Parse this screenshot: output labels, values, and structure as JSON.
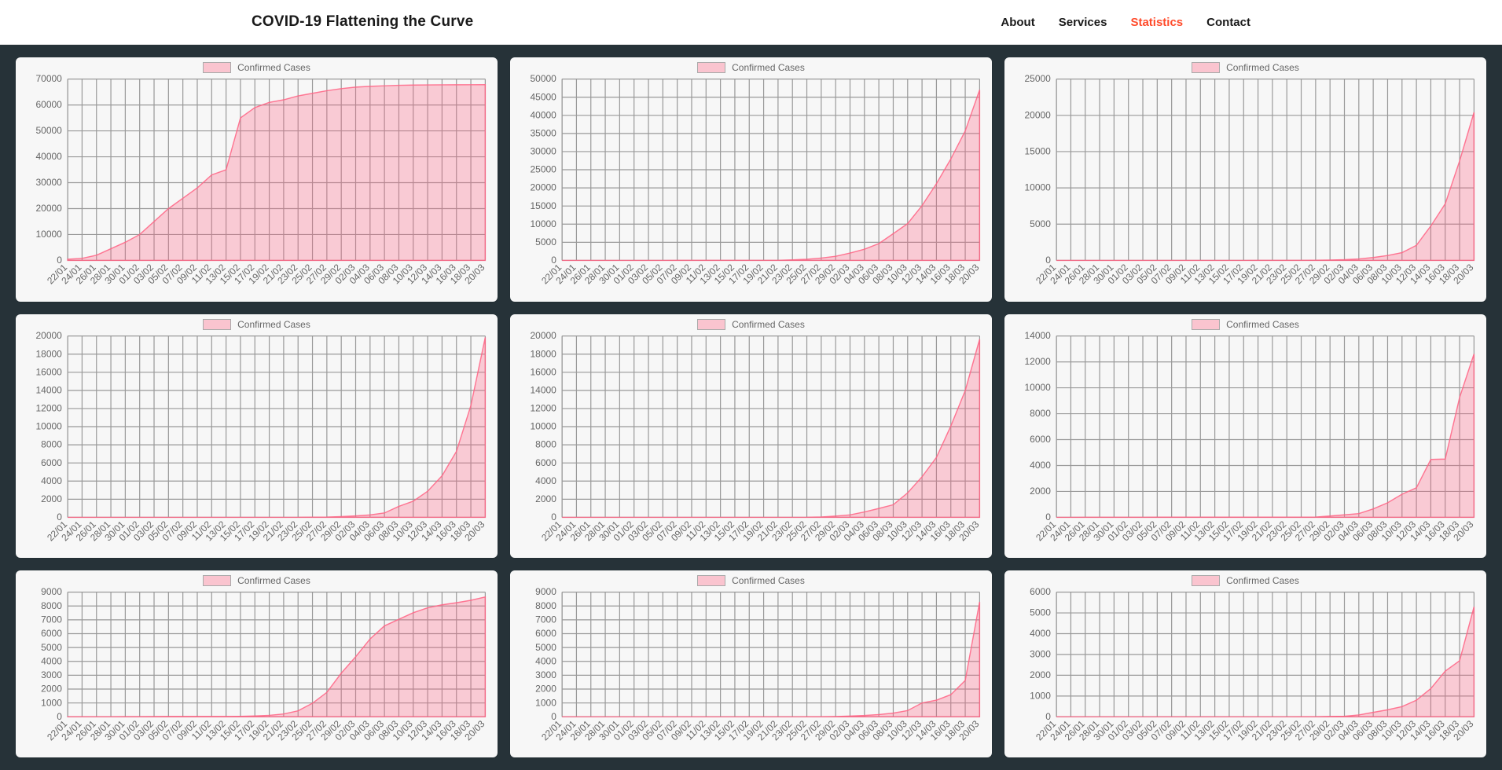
{
  "header": {
    "brand": "COVID-19 Flattening the Curve",
    "nav": {
      "about": "About",
      "services": "Services",
      "statistics": "Statistics",
      "contact": "Contact",
      "active": "statistics"
    }
  },
  "shared": {
    "legend_label": "Confirmed Cases",
    "categories": [
      "22/01",
      "24/01",
      "26/01",
      "28/01",
      "30/01",
      "01/02",
      "03/02",
      "05/02",
      "07/02",
      "09/02",
      "11/02",
      "13/02",
      "15/02",
      "17/02",
      "19/02",
      "21/02",
      "23/02",
      "25/02",
      "27/02",
      "29/02",
      "02/03",
      "04/03",
      "06/03",
      "08/03",
      "10/03",
      "12/03",
      "14/03",
      "16/03",
      "18/03",
      "20/03"
    ]
  },
  "chart_data": [
    {
      "id": "chart-1",
      "type": "area",
      "title": "",
      "xlabel": "",
      "ylabel": "",
      "ylim": [
        0,
        70000
      ],
      "yticks": [
        0,
        10000,
        20000,
        30000,
        40000,
        50000,
        60000,
        70000
      ],
      "series": [
        {
          "name": "Confirmed Cases",
          "values": [
            444,
            800,
            2000,
            4500,
            7000,
            10000,
            15000,
            20000,
            24000,
            28000,
            33000,
            35000,
            55000,
            59000,
            61000,
            62000,
            63500,
            64500,
            65500,
            66300,
            66900,
            67200,
            67400,
            67600,
            67700,
            67750,
            67780,
            67800,
            67820,
            67850
          ]
        }
      ]
    },
    {
      "id": "chart-2",
      "type": "area",
      "title": "",
      "xlabel": "",
      "ylabel": "",
      "ylim": [
        0,
        50000
      ],
      "yticks": [
        0,
        5000,
        10000,
        15000,
        20000,
        25000,
        30000,
        35000,
        40000,
        45000,
        50000
      ],
      "series": [
        {
          "name": "Confirmed Cases",
          "values": [
            0,
            0,
            0,
            0,
            0,
            2,
            2,
            2,
            3,
            3,
            3,
            3,
            3,
            3,
            3,
            20,
            155,
            322,
            650,
            1128,
            2036,
            3089,
            4636,
            7375,
            10149,
            15113,
            21157,
            27980,
            35713,
            47021
          ]
        }
      ]
    },
    {
      "id": "chart-3",
      "type": "area",
      "title": "",
      "xlabel": "",
      "ylabel": "",
      "ylim": [
        0,
        25000
      ],
      "yticks": [
        0,
        5000,
        10000,
        15000,
        20000,
        25000
      ],
      "series": [
        {
          "name": "Confirmed Cases",
          "values": [
            0,
            0,
            0,
            0,
            0,
            0,
            0,
            0,
            0,
            0,
            0,
            0,
            0,
            0,
            2,
            2,
            2,
            6,
            15,
            45,
            100,
            200,
            400,
            673,
            1073,
            2078,
            4747,
            7798,
            13716,
            20410
          ]
        }
      ]
    },
    {
      "id": "chart-4",
      "type": "area",
      "title": "",
      "xlabel": "",
      "ylabel": "",
      "ylim": [
        0,
        20000
      ],
      "yticks": [
        0,
        2000,
        4000,
        6000,
        8000,
        10000,
        12000,
        14000,
        16000,
        18000,
        20000
      ],
      "series": [
        {
          "name": "Confirmed Cases",
          "values": [
            0,
            0,
            0,
            0,
            0,
            0,
            0,
            0,
            0,
            0,
            0,
            0,
            0,
            0,
            0,
            0,
            0,
            17,
            27,
            79,
            157,
            262,
            482,
            1209,
            1784,
            2876,
            4585,
            7272,
            12327,
            19848
          ]
        }
      ]
    },
    {
      "id": "chart-5",
      "type": "area",
      "title": "",
      "xlabel": "",
      "ylabel": "",
      "ylim": [
        0,
        20000
      ],
      "yticks": [
        0,
        2000,
        4000,
        6000,
        8000,
        10000,
        12000,
        14000,
        16000,
        18000,
        20000
      ],
      "series": [
        {
          "name": "Confirmed Cases",
          "values": [
            0,
            0,
            0,
            0,
            0,
            0,
            0,
            0,
            0,
            0,
            0,
            0,
            0,
            0,
            0,
            0,
            0,
            2,
            43,
            141,
            270,
            593,
            978,
            1388,
            2700,
            4469,
            6607,
            10075,
            13980,
            19644
          ]
        }
      ]
    },
    {
      "id": "chart-6",
      "type": "area",
      "title": "",
      "xlabel": "",
      "ylabel": "",
      "ylim": [
        0,
        14000
      ],
      "yticks": [
        0,
        2000,
        4000,
        6000,
        8000,
        10000,
        12000,
        14000
      ],
      "series": [
        {
          "name": "Confirmed Cases",
          "values": [
            0,
            0,
            2,
            4,
            5,
            6,
            6,
            10,
            11,
            12,
            12,
            12,
            12,
            12,
            12,
            12,
            12,
            14,
            18,
            100,
            191,
            285,
            653,
            1126,
            1784,
            2281,
            4469,
            4499,
            9257,
            12612
          ]
        }
      ]
    },
    {
      "id": "chart-7",
      "type": "area",
      "title": "",
      "xlabel": "",
      "ylabel": "",
      "ylim": [
        0,
        9000
      ],
      "yticks": [
        0,
        1000,
        2000,
        3000,
        4000,
        5000,
        6000,
        7000,
        8000,
        9000
      ],
      "series": [
        {
          "name": "Confirmed Cases",
          "values": [
            1,
            2,
            3,
            4,
            11,
            12,
            15,
            24,
            25,
            27,
            28,
            28,
            33,
            59,
            104,
            204,
            433,
            977,
            1766,
            3150,
            4335,
            5621,
            6566,
            7041,
            7513,
            7869,
            8086,
            8236,
            8413,
            8652
          ]
        }
      ]
    },
    {
      "id": "chart-8",
      "type": "area",
      "title": "",
      "xlabel": "",
      "ylabel": "",
      "ylim": [
        0,
        9000
      ],
      "yticks": [
        0,
        1000,
        2000,
        3000,
        4000,
        5000,
        6000,
        7000,
        8000,
        9000
      ],
      "series": [
        {
          "name": "Confirmed Cases",
          "values": [
            0,
            0,
            0,
            0,
            0,
            0,
            0,
            0,
            0,
            0,
            0,
            0,
            0,
            0,
            0,
            0,
            0,
            1,
            7,
            20,
            51,
            93,
            163,
            265,
            450,
            1000,
            1200,
            1600,
            2626,
            8300
          ]
        }
      ]
    },
    {
      "id": "chart-9",
      "type": "area",
      "title": "",
      "xlabel": "",
      "ylabel": "",
      "ylim": [
        0,
        6000
      ],
      "yticks": [
        0,
        1000,
        2000,
        3000,
        4000,
        5000,
        6000
      ],
      "series": [
        {
          "name": "Confirmed Cases",
          "values": [
            0,
            0,
            0,
            0,
            0,
            0,
            0,
            0,
            0,
            0,
            0,
            0,
            0,
            0,
            0,
            0,
            0,
            1,
            1,
            18,
            27,
            90,
            214,
            337,
            491,
            800,
            1359,
            2200,
            2700,
            5294
          ]
        }
      ]
    }
  ]
}
